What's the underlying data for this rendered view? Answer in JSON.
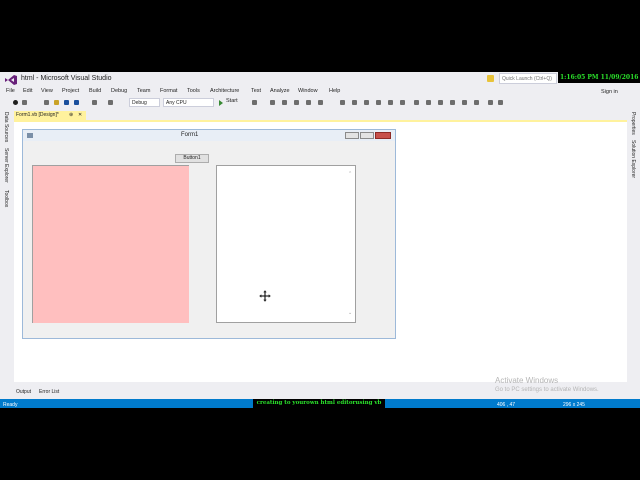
{
  "window": {
    "title": "html - Microsoft Visual Studio",
    "quick_launch_placeholder": "Quick Launch (Ctrl+Q)",
    "clock": "1:16:05 PM 11/09/2016",
    "sign_in": "Sign in"
  },
  "menu": [
    "File",
    "Edit",
    "View",
    "Project",
    "Build",
    "Debug",
    "Team",
    "Format",
    "Tools",
    "Architecture",
    "Test",
    "Analyze",
    "Window",
    "Help"
  ],
  "toolbar": {
    "config": "Debug",
    "platform": "Any CPU",
    "start_label": "Start"
  },
  "left_tabs": [
    "Data Sources",
    "Server Explorer",
    "Toolbox"
  ],
  "right_tabs": [
    "Properties",
    "Solution Explorer"
  ],
  "document_tab": "Form1.vb [Design]*",
  "form": {
    "title": "Form1",
    "button_label": "Button1"
  },
  "bottom_tabs": [
    "Output",
    "Error List"
  ],
  "watermark": {
    "line1": "Activate Windows",
    "line2": "Go to PC settings to activate Windows."
  },
  "status": {
    "left": "Ready",
    "position": "406 , 47",
    "size": "296 x 245"
  },
  "banner": "creating to yourown html editorusing vb",
  "colors": {
    "accent": "#007ACC",
    "pink_panel": "#FFBFBF",
    "doc_tab": "#FFF29D"
  }
}
